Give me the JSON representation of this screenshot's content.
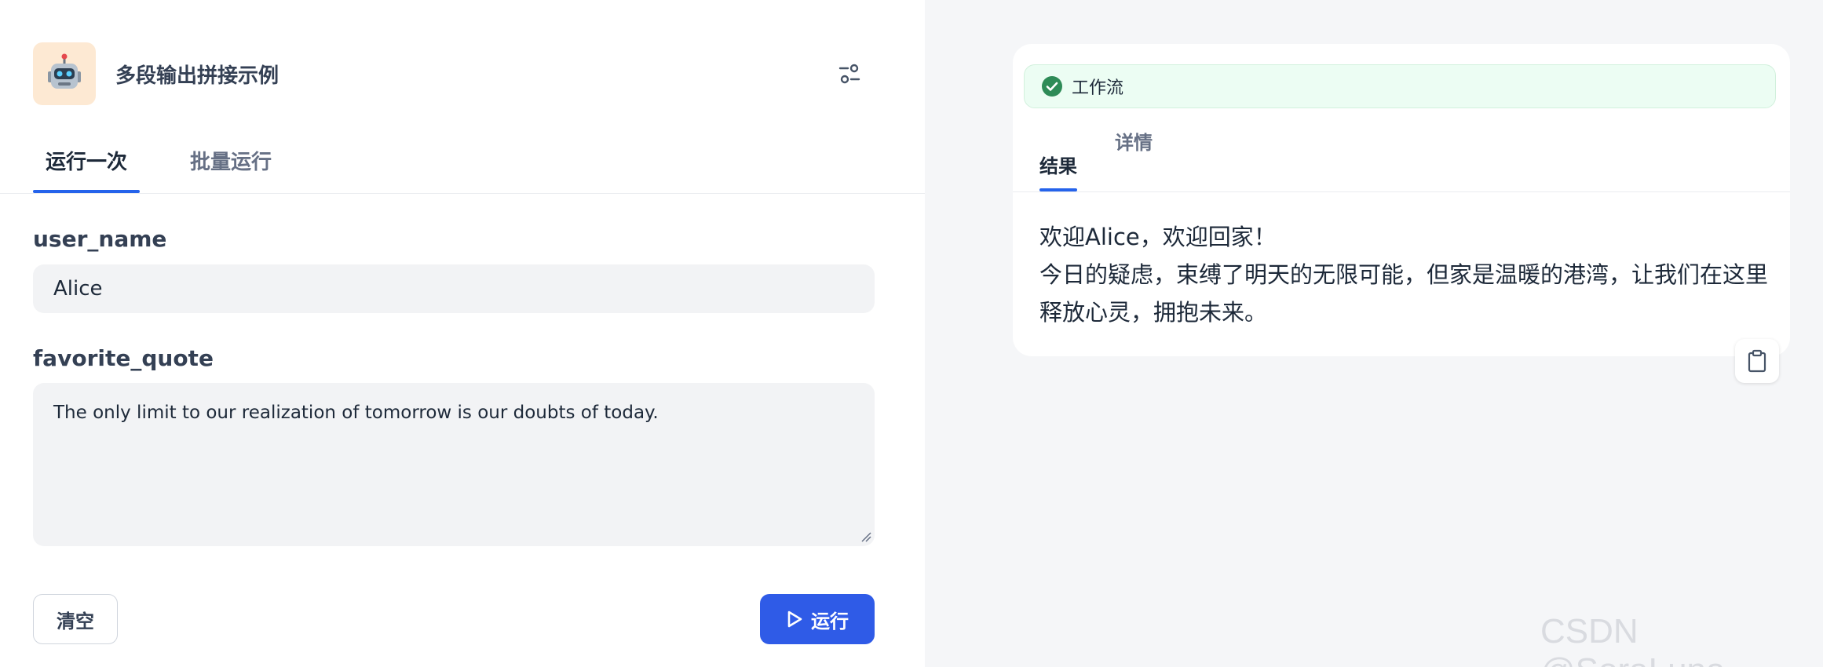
{
  "app": {
    "title": "多段输出拼接示例",
    "icon": "robot-emoji",
    "icon_bg": "#fde9d3"
  },
  "tabs": [
    {
      "label": "运行一次",
      "active": true
    },
    {
      "label": "批量运行",
      "active": false
    }
  ],
  "form": {
    "fields": [
      {
        "label": "user_name",
        "value": "Alice"
      },
      {
        "label": "favorite_quote",
        "value": "The only limit to our realization of tomorrow is our doubts of today."
      }
    ],
    "clear_label": "清空",
    "run_label": "运行"
  },
  "result": {
    "status_label": "工作流",
    "status_color": "#2e8b57",
    "tabs": [
      {
        "label": "结果",
        "active": true
      },
      {
        "label": "详情",
        "active": false
      }
    ],
    "output_line1": "欢迎Alice，欢迎回家！",
    "output_line2": "今日的疑虑，束缚了明天的无限可能，但家是温暖的港湾，让我们在这里释放心灵，拥抱未来。"
  },
  "watermark": "CSDN @SoraLuna",
  "colors": {
    "accent": "#2f5be7",
    "tab_indicator": "#2563eb",
    "input_bg": "#f2f3f5",
    "right_bg": "#f5f6f8"
  }
}
